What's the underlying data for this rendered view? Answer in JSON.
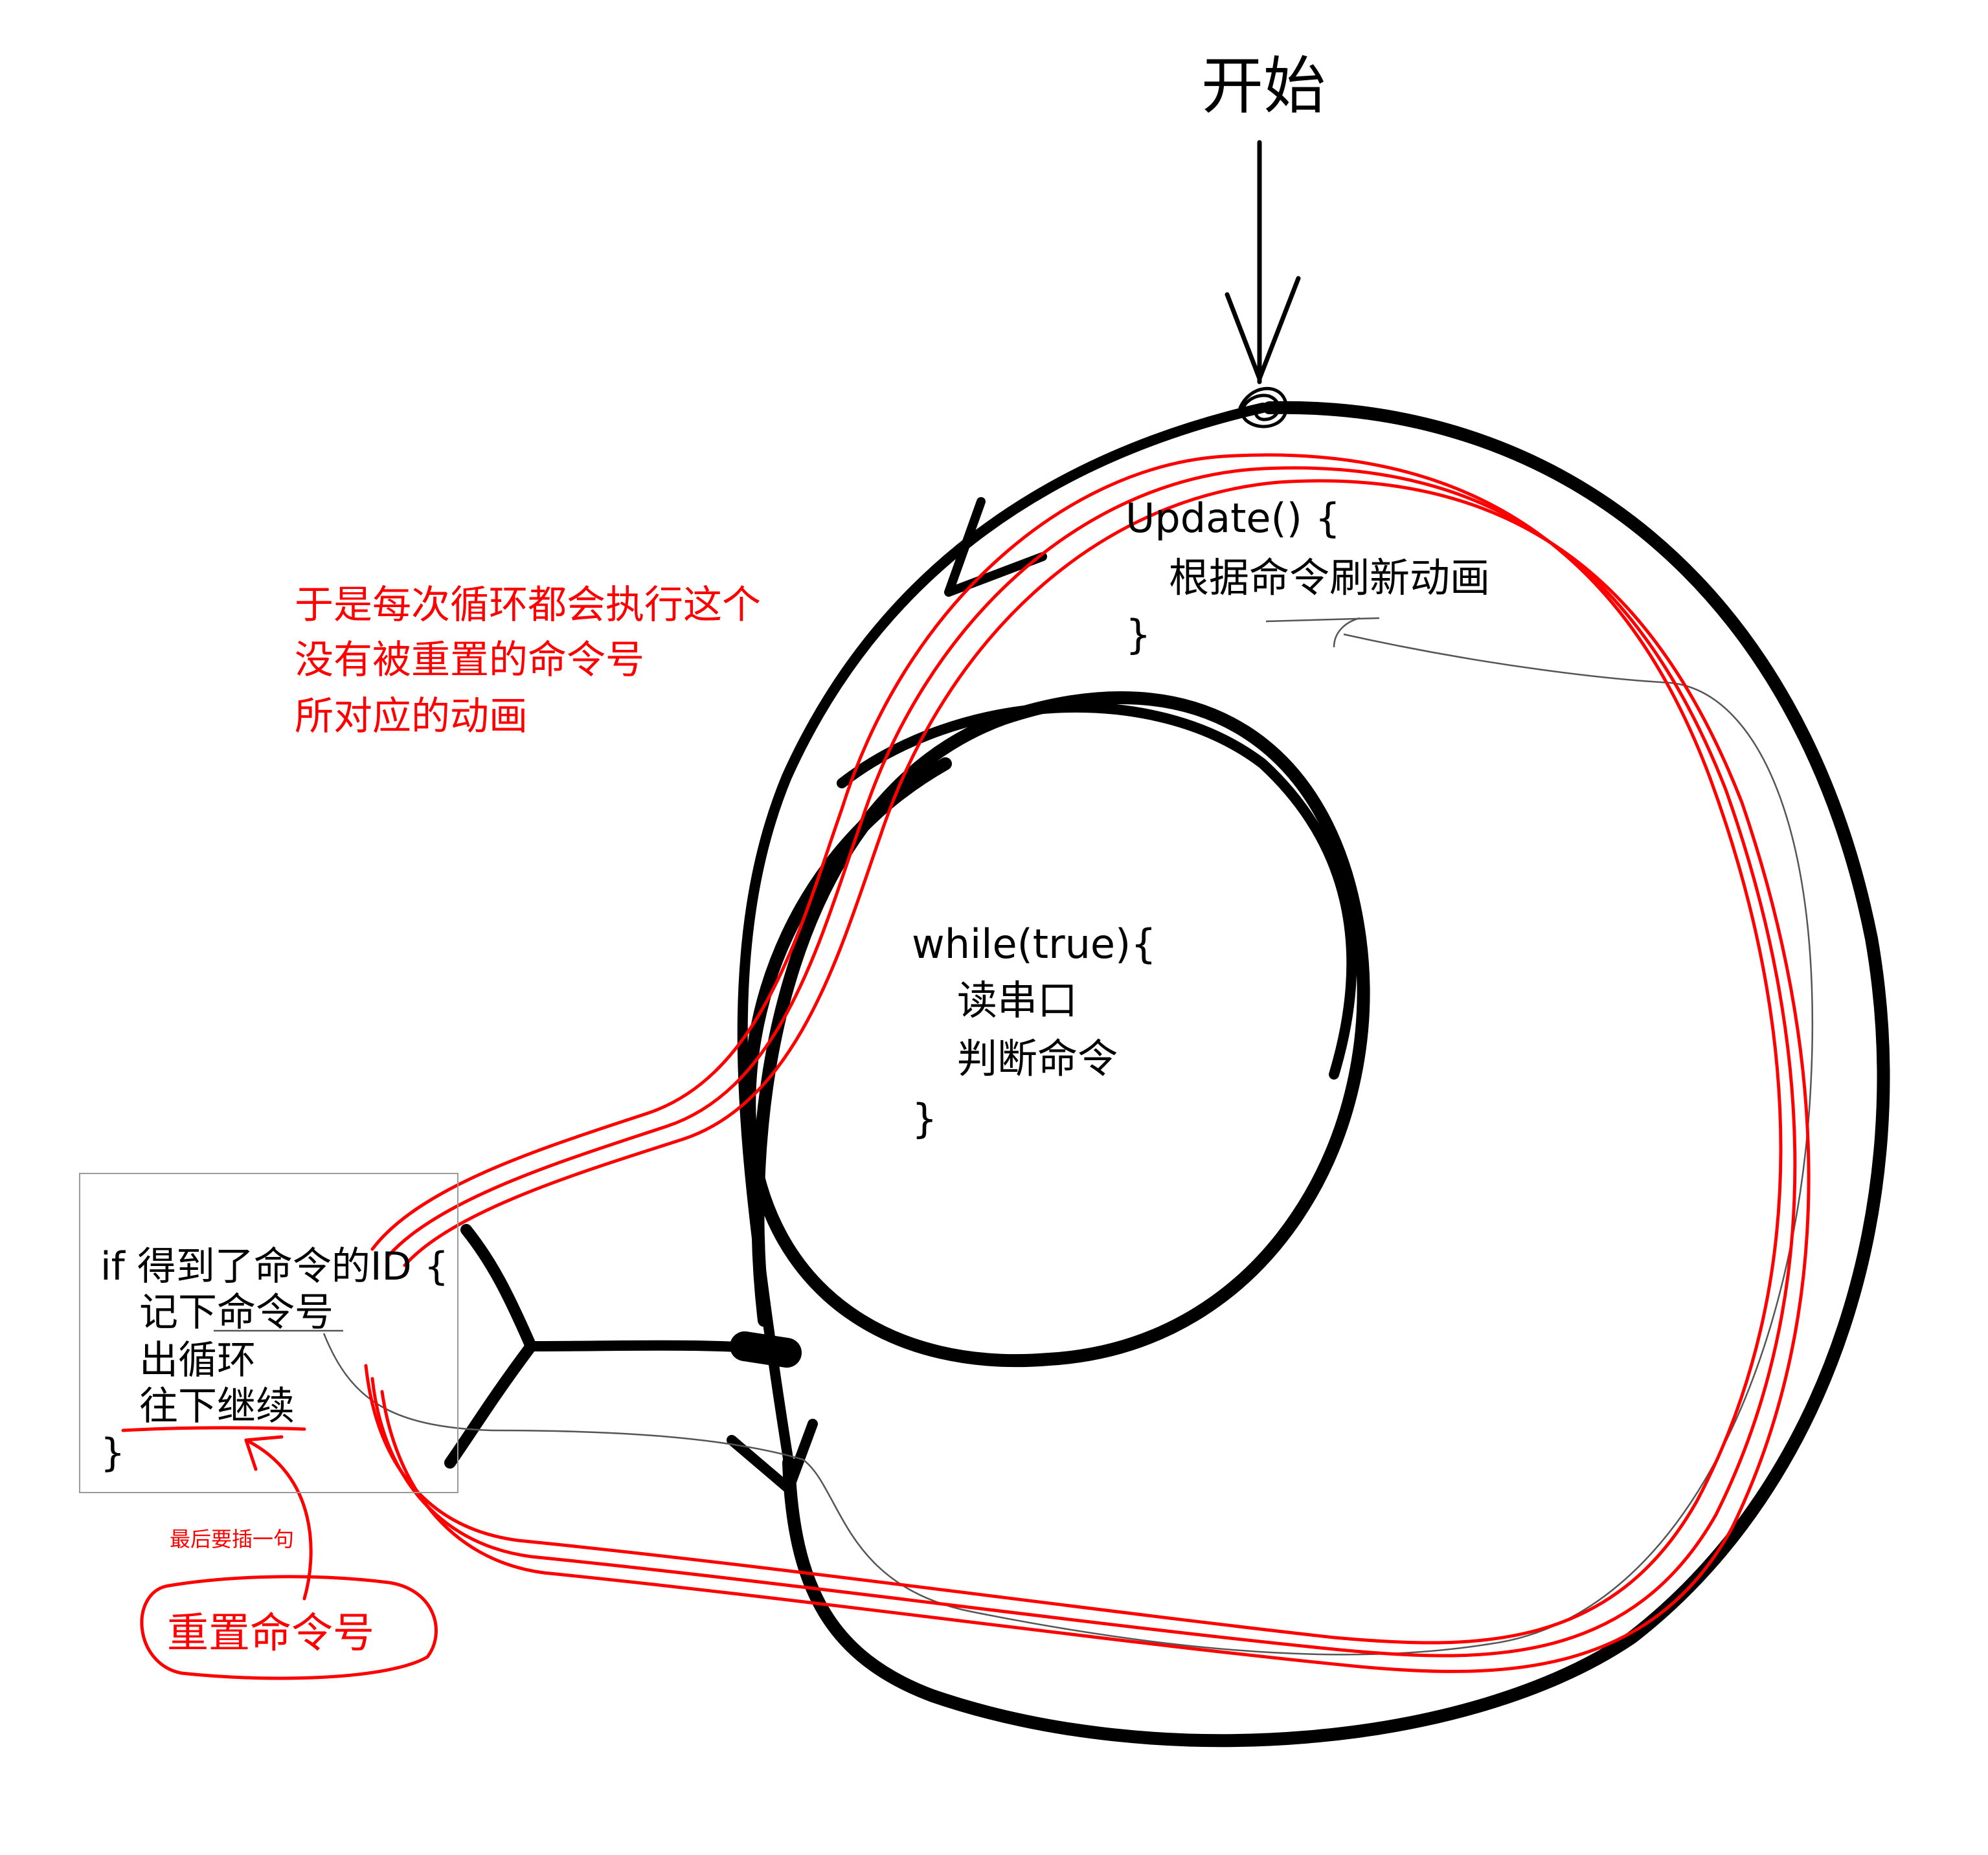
{
  "colors": {
    "ink": "#000000",
    "annotation": "#ff0000",
    "thin": "#555555",
    "box_border": "#9a9a9a"
  },
  "start_label": "开始",
  "update_block": {
    "line1": "Update() {",
    "line2": "根据命令刷新动画",
    "line3": "}"
  },
  "while_block": {
    "line1": "while(true){",
    "line2": "读串口",
    "line3": "判断命令",
    "line4": "}"
  },
  "if_block": {
    "line1": "if 得到了命令的ID {",
    "line2": "记下命令号",
    "line3": "出循环",
    "line4": "往下继续",
    "line5": "}"
  },
  "red_note": {
    "line1": "于是每次循环都会执行这个",
    "line2": "没有被重置的命令号",
    "line3": "所对应的动画"
  },
  "insert_note": "最后要插一句",
  "reset_label": "重置命令号"
}
